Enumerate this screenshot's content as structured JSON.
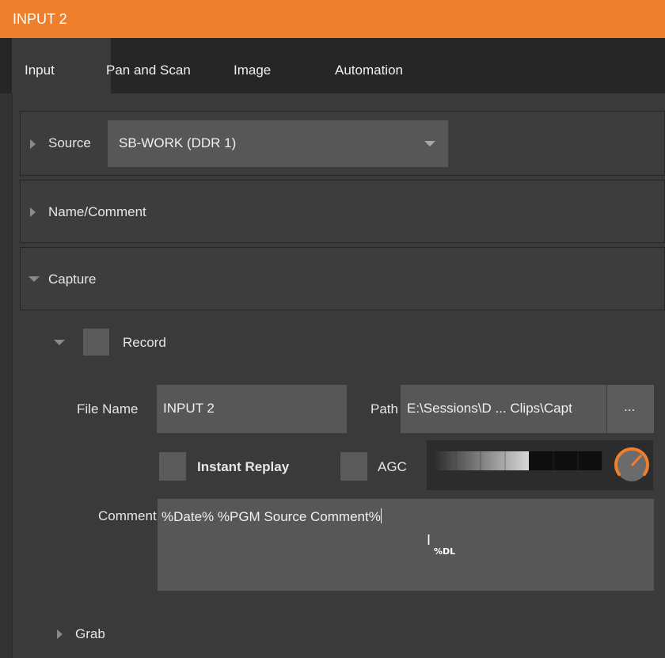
{
  "window": {
    "title": "INPUT 2"
  },
  "tabs": [
    {
      "label": "Input",
      "active": true
    },
    {
      "label": "Pan and Scan",
      "active": false
    },
    {
      "label": "Image",
      "active": false
    },
    {
      "label": "Automation",
      "active": false
    }
  ],
  "source": {
    "label": "Source",
    "value": "SB-WORK (DDR 1)"
  },
  "name_comment": {
    "label": "Name/Comment"
  },
  "capture": {
    "label": "Capture",
    "record_label": "Record",
    "file_name_label": "File Name",
    "file_name_value": "INPUT 2",
    "path_label": "Path",
    "path_value": "E:\\Sessions\\D ... Clips\\Capt",
    "browse_label": "...",
    "instant_replay_label": "Instant Replay",
    "agc_label": "AGC",
    "comment_label": "Comment",
    "comment_value": "%Date% %PGM Source Comment%",
    "cursor_hint": "%DL"
  },
  "grab": {
    "label": "Grab"
  },
  "colors": {
    "accent": "#ee7f2d",
    "tab_bar": "#262626",
    "panel": "#3a3a3a",
    "field": "#575757"
  },
  "icons": {
    "expand": "triangle-right-icon",
    "collapse": "triangle-down-icon",
    "dropdown": "triangle-down-icon",
    "knob": "rotary-knob-icon",
    "cursor": "text-cursor-icon"
  }
}
